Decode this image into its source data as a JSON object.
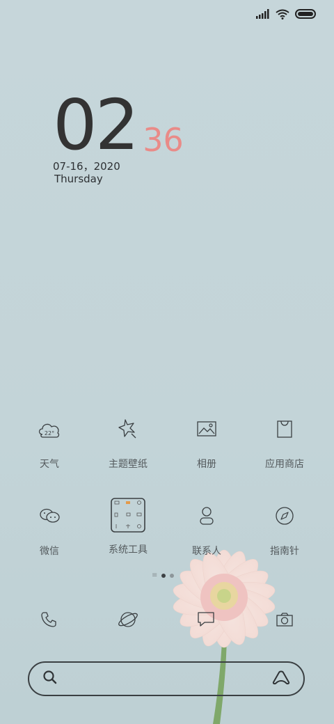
{
  "status_bar": {
    "icons": [
      "signal-icon",
      "wifi-icon",
      "battery-icon"
    ]
  },
  "clock": {
    "hours": "02",
    "minutes": "36",
    "date": "07-16，2020",
    "weekday": "Thursday",
    "minutes_color": "#e98b88"
  },
  "apps_row1": [
    {
      "label": "天气",
      "icon": "weather-icon",
      "temp": "22°"
    },
    {
      "label": "主题壁纸",
      "icon": "theme-icon"
    },
    {
      "label": "相册",
      "icon": "gallery-icon"
    },
    {
      "label": "应用商店",
      "icon": "app-store-icon"
    }
  ],
  "apps_row2": [
    {
      "label": "微信",
      "icon": "wechat-icon"
    },
    {
      "label": "系统工具",
      "icon": "system-tools-folder-icon"
    },
    {
      "label": "联系人",
      "icon": "contacts-icon"
    },
    {
      "label": "指南针",
      "icon": "compass-icon"
    }
  ],
  "page_indicator": {
    "pages": 2,
    "current": 0
  },
  "dock": [
    "phone-icon",
    "browser-icon",
    "messages-icon",
    "camera-icon"
  ],
  "search": {
    "placeholder": ""
  }
}
